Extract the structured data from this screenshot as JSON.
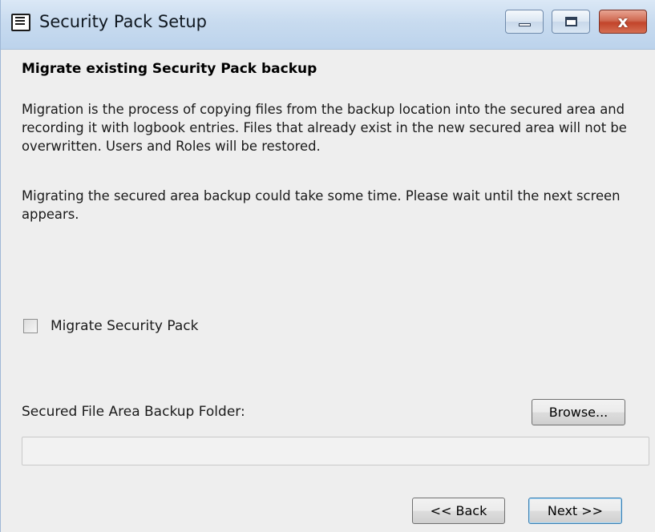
{
  "window": {
    "title": "Security Pack Setup",
    "close_glyph": "x"
  },
  "page": {
    "heading": "Migrate existing Security Pack backup",
    "paragraph1": "Migration is the process of copying files from the backup location into the secured area and recording it with logbook entries. Files that already exist in the new secured area will not be overwritten. Users and Roles will be restored.",
    "paragraph2": "Migrating the secured area backup could take some time. Please wait until the next screen appears.",
    "migrate_checkbox": {
      "label": "Migrate Security Pack",
      "checked": false
    },
    "folder": {
      "label": "Secured File Area Backup Folder:",
      "value": "",
      "browse_label": "Browse..."
    }
  },
  "footer": {
    "back_label": "<< Back",
    "next_label": "Next >>"
  },
  "icons": {
    "app": "computer-icon",
    "minimize": "minimize-icon",
    "maximize": "maximize-icon",
    "close": "close-icon"
  }
}
